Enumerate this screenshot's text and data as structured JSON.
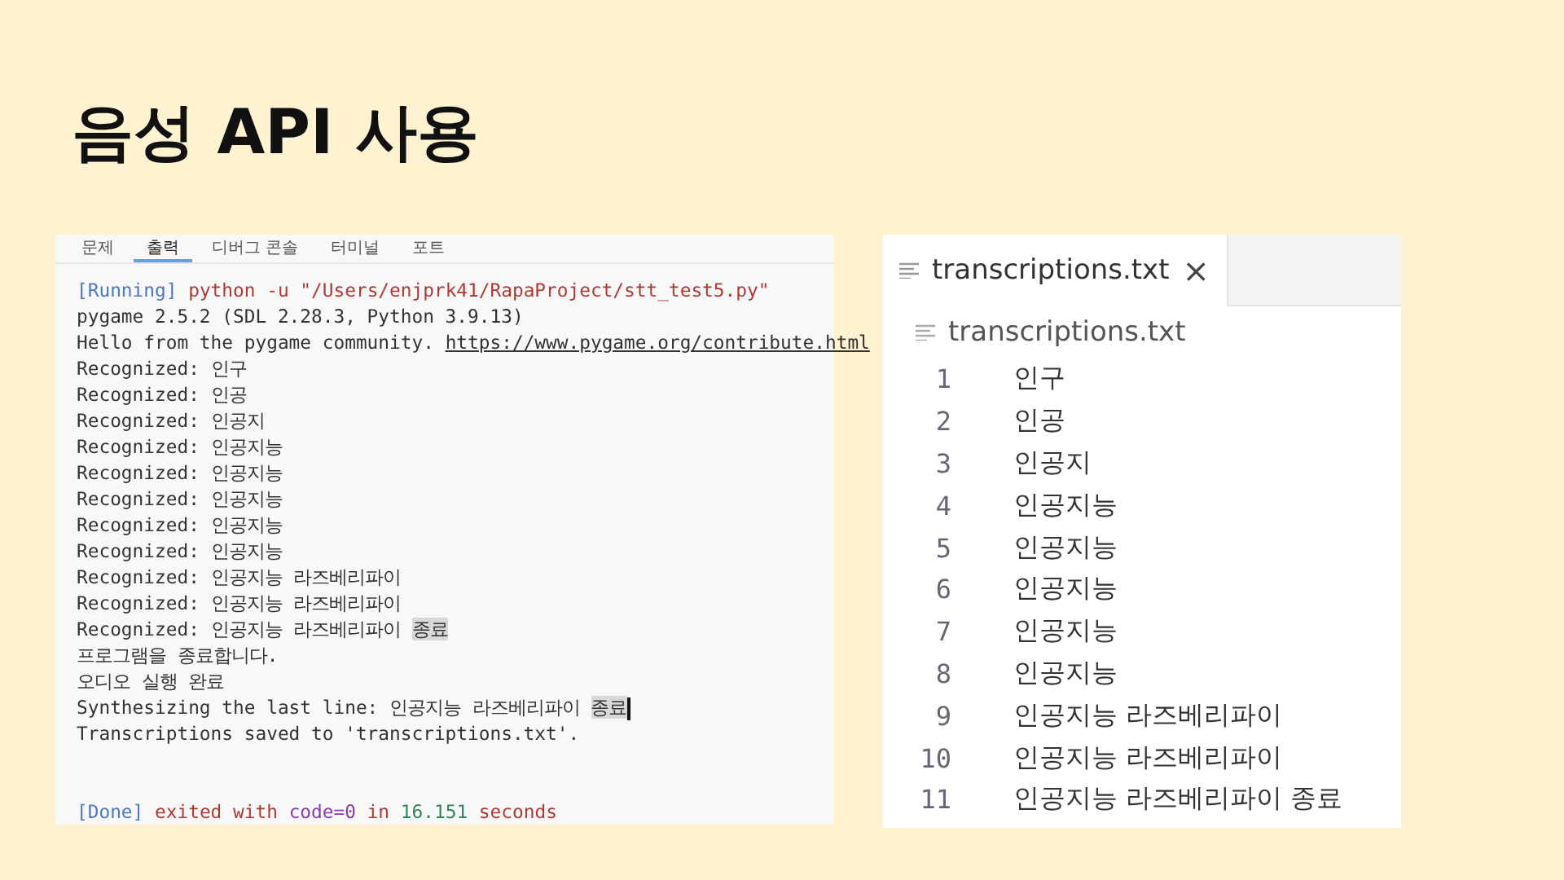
{
  "slide_title": "음성 API 사용",
  "output_panel": {
    "tabs": [
      {
        "label": "문제",
        "selected": false
      },
      {
        "label": "출력",
        "selected": true
      },
      {
        "label": "디버그 콘솔",
        "selected": false
      },
      {
        "label": "터미널",
        "selected": false
      },
      {
        "label": "포트",
        "selected": false
      }
    ],
    "lines": [
      [
        {
          "text": "[Running]",
          "kind": "tag"
        },
        {
          "text": " python -u \"/Users/enjprk41/RapaProject/stt_test5.py\"",
          "kind": "command"
        }
      ],
      [
        {
          "text": "pygame 2.5.2 (SDL 2.28.3, Python 3.9.13)",
          "kind": "plain"
        }
      ],
      [
        {
          "text": "Hello from the pygame community. ",
          "kind": "plain"
        },
        {
          "text": "https://www.pygame.org/contribute.html",
          "kind": "link"
        }
      ],
      [
        {
          "text": "Recognized: 인구",
          "kind": "plain"
        }
      ],
      [
        {
          "text": "Recognized: 인공",
          "kind": "plain"
        }
      ],
      [
        {
          "text": "Recognized: 인공지",
          "kind": "plain"
        }
      ],
      [
        {
          "text": "Recognized: 인공지능",
          "kind": "plain"
        }
      ],
      [
        {
          "text": "Recognized: 인공지능",
          "kind": "plain"
        }
      ],
      [
        {
          "text": "Recognized: 인공지능",
          "kind": "plain"
        }
      ],
      [
        {
          "text": "Recognized: 인공지능",
          "kind": "plain"
        }
      ],
      [
        {
          "text": "Recognized: 인공지능",
          "kind": "plain"
        }
      ],
      [
        {
          "text": "Recognized: 인공지능 라즈베리파이",
          "kind": "plain"
        }
      ],
      [
        {
          "text": "Recognized: 인공지능 라즈베리파이",
          "kind": "plain"
        }
      ],
      [
        {
          "text": "Recognized: 인공지능 라즈베리파이 ",
          "kind": "plain"
        },
        {
          "text": "종료",
          "kind": "highlight"
        }
      ],
      [
        {
          "text": "프로그램을 종료합니다.",
          "kind": "plain"
        }
      ],
      [
        {
          "text": "오디오 실행 완료",
          "kind": "plain"
        }
      ],
      [
        {
          "text": "Synthesizing the last line: 인공지능 라즈베리파이 ",
          "kind": "plain"
        },
        {
          "text": "종료",
          "kind": "highlight",
          "cursor": true
        }
      ],
      [
        {
          "text": "Transcriptions saved to 'transcriptions.txt'.",
          "kind": "plain"
        }
      ]
    ],
    "status_line": [
      {
        "text": "[Done]",
        "kind": "tag"
      },
      {
        "text": " exited with ",
        "kind": "command"
      },
      {
        "text": "code=0",
        "kind": "code"
      },
      {
        "text": " in ",
        "kind": "command"
      },
      {
        "text": "16.151",
        "kind": "number"
      },
      {
        "text": " seconds",
        "kind": "command"
      }
    ]
  },
  "editor": {
    "tab": {
      "label": "transcriptions.txt",
      "close": "×"
    },
    "breadcrumb": "transcriptions.txt",
    "lines": [
      {
        "number": "1",
        "text": "인구"
      },
      {
        "number": "2",
        "text": "인공"
      },
      {
        "number": "3",
        "text": "인공지"
      },
      {
        "number": "4",
        "text": "인공지능"
      },
      {
        "number": "5",
        "text": "인공지능"
      },
      {
        "number": "6",
        "text": "인공지능"
      },
      {
        "number": "7",
        "text": "인공지능"
      },
      {
        "number": "8",
        "text": "인공지능"
      },
      {
        "number": "9",
        "text": "인공지능 라즈베리파이"
      },
      {
        "number": "10",
        "text": "인공지능 라즈베리파이"
      },
      {
        "number": "11",
        "text": "인공지능 라즈베리파이 종료"
      }
    ]
  }
}
